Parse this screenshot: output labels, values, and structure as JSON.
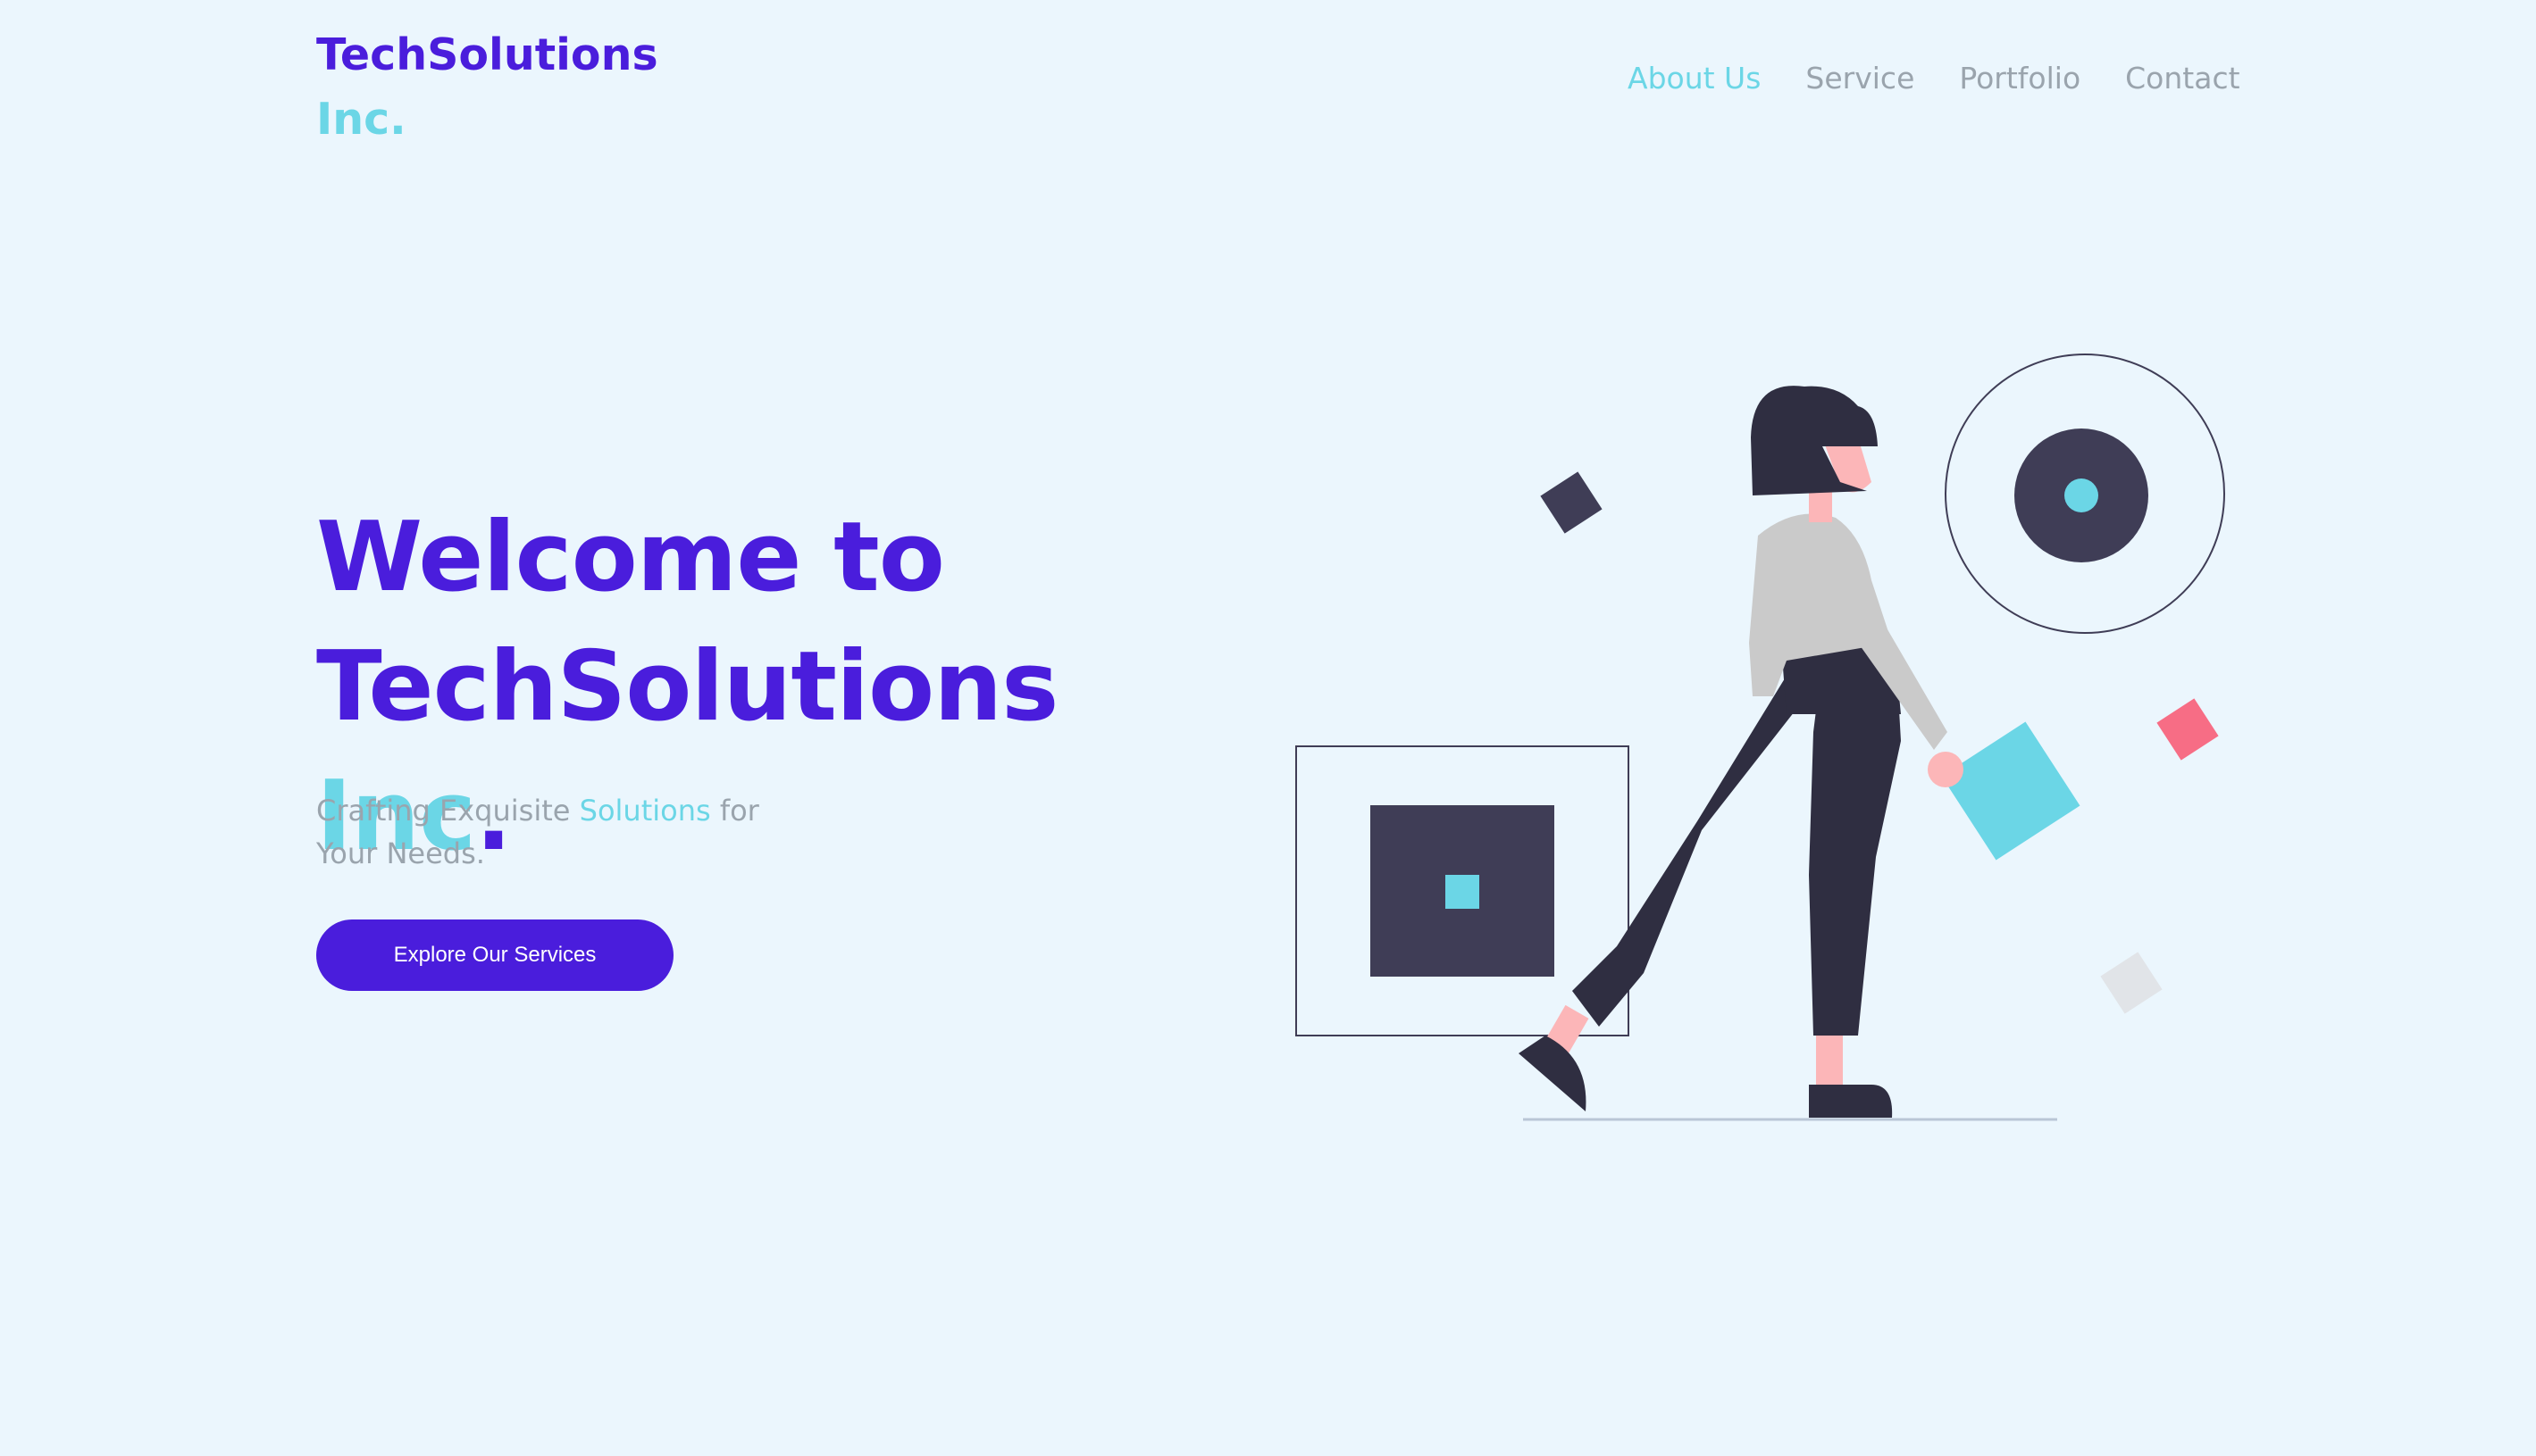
{
  "brand": {
    "name_main": "TechSolutions",
    "name_accent": "Inc."
  },
  "nav": {
    "items": [
      {
        "label": "About Us",
        "active": true
      },
      {
        "label": "Service",
        "active": false
      },
      {
        "label": "Portfolio",
        "active": false
      },
      {
        "label": "Contact",
        "active": false
      }
    ]
  },
  "hero": {
    "title_line1": "Welcome to",
    "title_brand": "TechSolutions",
    "title_accent": "Inc",
    "title_period": ".",
    "subtitle_before": "Crafting Exquisite ",
    "subtitle_accent": "Solutions",
    "subtitle_after": " for Your Needs.",
    "cta_label": "Explore Our Services"
  },
  "colors": {
    "primary": "#4a1ddc",
    "accent": "#6bd6e6",
    "muted_text": "#9aa4ad",
    "background": "#ebf6fd",
    "dark_shape": "#3f3d56",
    "pink": "#f76d85"
  },
  "illustration": {
    "description_icon": "woman-walking-illustration"
  }
}
